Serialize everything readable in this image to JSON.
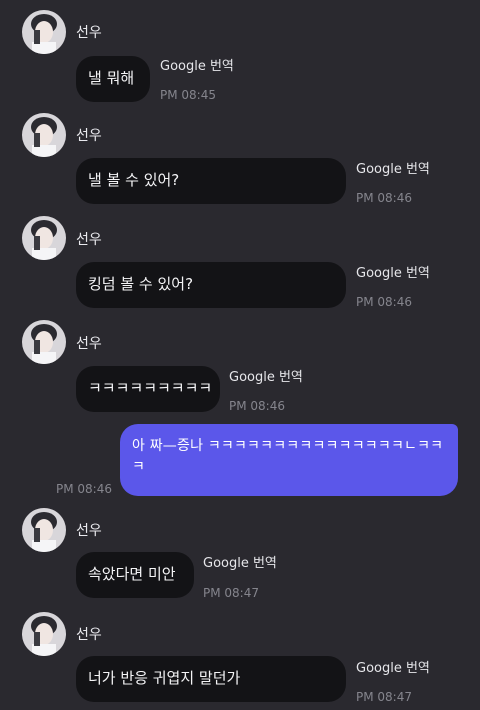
{
  "messages": [
    {
      "sender": "선우",
      "text": "낼 뭐해",
      "translate": "Google 번역",
      "time": "PM 08:45"
    },
    {
      "sender": "선우",
      "text": "낼 볼 수 있어?",
      "translate": "Google 번역",
      "time": "PM 08:46"
    },
    {
      "sender": "선우",
      "text": "킹덤 볼 수 있어?",
      "translate": "Google 번역",
      "time": "PM 08:46"
    },
    {
      "sender": "선우",
      "text": "ㅋㅋㅋㅋㅋㅋㅋㅋㅋ",
      "translate": "Google 번역",
      "time": "PM 08:46"
    },
    {
      "sender": "선우",
      "text": "속았다면 미안",
      "translate": "Google 번역",
      "time": "PM 08:47"
    },
    {
      "sender": "선우",
      "text": "너가 반응 귀엽지 말던가",
      "translate": "Google 번역",
      "time": "PM 08:47"
    }
  ],
  "my_message": {
    "text": "아 짜—증나 ㅋㅋㅋㅋㅋㅋㅋㅋㅋㅋㅋㅋㅋㅋㅋㄴㅋㅋㅋ",
    "time": "PM 08:46"
  },
  "colors": {
    "background": "#2a292f",
    "incoming_bubble": "#131316",
    "outgoing_bubble": "#5b57ea",
    "timestamp": "#85858d"
  },
  "icons": {
    "avatar": "profile-photo"
  }
}
